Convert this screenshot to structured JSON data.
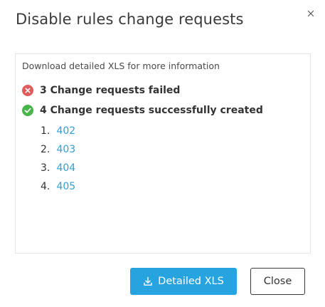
{
  "dialog": {
    "title": "Disable rules change requests",
    "close_icon": "close-icon"
  },
  "panel": {
    "hint": "Download detailed XLS for more information",
    "failed": {
      "icon": "error-circle-icon",
      "text": "3 Change requests failed",
      "color": "#e05b5b"
    },
    "success": {
      "icon": "check-circle-icon",
      "text": "4 Change requests successfully created",
      "color": "#48b44a"
    },
    "requests": [
      {
        "index": "1.",
        "id": "402"
      },
      {
        "index": "2.",
        "id": "403"
      },
      {
        "index": "3.",
        "id": "404"
      },
      {
        "index": "4.",
        "id": "405"
      }
    ],
    "link_color": "#2e9fd6"
  },
  "footer": {
    "download_label": "Detailed XLS",
    "download_icon": "download-icon",
    "close_label": "Close",
    "accent": "#27a4df"
  }
}
